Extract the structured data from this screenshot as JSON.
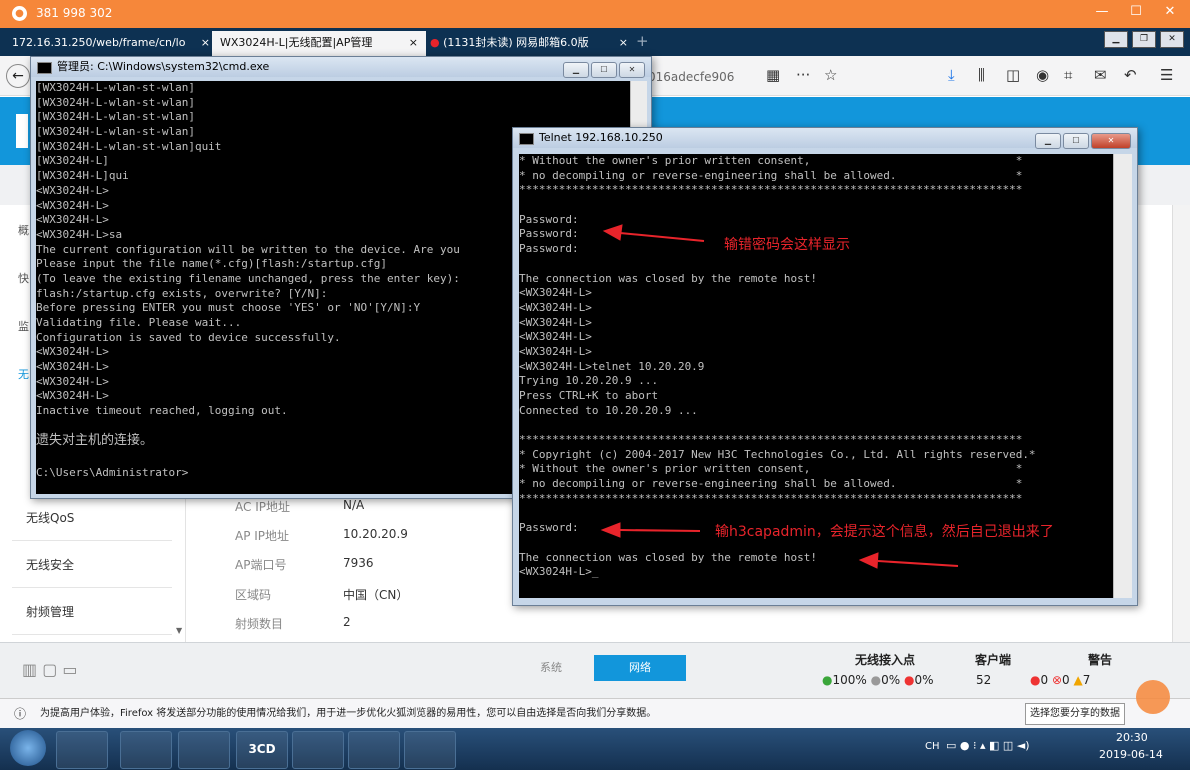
{
  "remote": {
    "title": "381 998 302"
  },
  "browser": {
    "tabs": [
      {
        "label": "172.16.31.250/web/frame/cn/lo",
        "close": "×"
      },
      {
        "label": "WX3024H-L|无线配置|AP管理",
        "close": "×"
      },
      {
        "label": "(1131封未读) 网易邮箱6.0版",
        "close": "×"
      }
    ],
    "url_fragment": "016adecfe906",
    "toolbar_more": "···"
  },
  "page": {
    "sidebar": [
      "无线QoS",
      "无线安全",
      "射频管理"
    ],
    "side_partial": [
      "概",
      "快",
      "监",
      "无"
    ],
    "details": [
      {
        "key": "AC IP地址",
        "value": "N/A"
      },
      {
        "key": "AP IP地址",
        "value": "10.20.20.9"
      },
      {
        "key": "AP端口号",
        "value": "7936"
      },
      {
        "key": "区域码",
        "value": "中国（CN）"
      },
      {
        "key": "射频数目",
        "value": "2"
      }
    ],
    "status": {
      "tabs": [
        "系统",
        "网络"
      ],
      "ap_label": "无线接入点",
      "ap_stats": [
        "100%",
        "0%",
        "0%"
      ],
      "client_label": "客户端",
      "client_count": "52",
      "alarm_label": "警告",
      "alarm_counts": [
        "0",
        "0",
        "7"
      ]
    }
  },
  "notification": {
    "text": "为提高用户体验，Firefox 将发送部分功能的使用情况给我们，用于进一步优化火狐浏览器的易用性，您可以自由选择是否向我们分享数据。",
    "button": "选择您要分享的数据"
  },
  "cmd": {
    "title": "管理员: C:\\Windows\\system32\\cmd.exe",
    "lines": [
      "[WX3024H-L-wlan-st-wlan]",
      "[WX3024H-L-wlan-st-wlan]",
      "[WX3024H-L-wlan-st-wlan]",
      "[WX3024H-L-wlan-st-wlan]",
      "[WX3024H-L-wlan-st-wlan]quit",
      "[WX3024H-L]",
      "[WX3024H-L]qui",
      "<WX3024H-L>",
      "<WX3024H-L>",
      "<WX3024H-L>",
      "<WX3024H-L>sa",
      "The current configuration will be written to the device. Are you",
      "Please input the file name(*.cfg)[flash:/startup.cfg]",
      "(To leave the existing filename unchanged, press the enter key):",
      "flash:/startup.cfg exists, overwrite? [Y/N]:",
      "Before pressing ENTER you must choose 'YES' or 'NO'[Y/N]:Y",
      "Validating file. Please wait...",
      "Configuration is saved to device successfully.",
      "<WX3024H-L>",
      "<WX3024H-L>",
      "<WX3024H-L>",
      "<WX3024H-L>",
      "Inactive timeout reached, logging out."
    ],
    "lost": "遗失对主机的连接。",
    "prompt": "C:\\Users\\Administrator>"
  },
  "telnet": {
    "title": "Telnet 192.168.10.250",
    "lines": [
      "* Without the owner's prior written consent,                               *",
      "* no decompiling or reverse-engineering shall be allowed.                  *",
      "****************************************************************************",
      "",
      "Password:",
      "Password:",
      "Password:",
      "",
      "The connection was closed by the remote host!",
      "<WX3024H-L>",
      "<WX3024H-L>",
      "<WX3024H-L>",
      "<WX3024H-L>",
      "<WX3024H-L>",
      "<WX3024H-L>telnet 10.20.20.9",
      "Trying 10.20.20.9 ...",
      "Press CTRL+K to abort",
      "Connected to 10.20.20.9 ...",
      "",
      "****************************************************************************",
      "* Copyright (c) 2004-2017 New H3C Technologies Co., Ltd. All rights reserved.*",
      "* Without the owner's prior written consent,                               *",
      "* no decompiling or reverse-engineering shall be allowed.                  *",
      "****************************************************************************",
      "",
      "Password:",
      "",
      "The connection was closed by the remote host!",
      "<WX3024H-L>_"
    ],
    "annotations": [
      "输错密码会这样显示",
      "输h3capadmin，会提示这个信息，然后自己退出来了"
    ]
  },
  "taskbar": {
    "lang": "CH",
    "time": "20:30",
    "date": "2019-06-14",
    "app_3cd": "3CD"
  },
  "colors": {
    "accent": "#1296db",
    "remote_bar": "#f6873a",
    "annotation": "#e8242b"
  }
}
